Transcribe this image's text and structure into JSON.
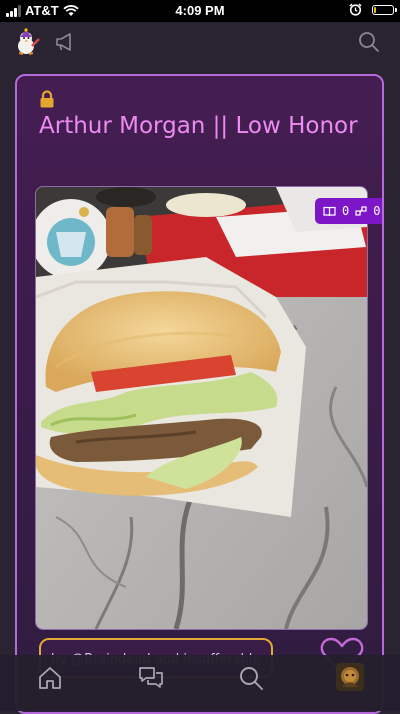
{
  "status_bar": {
    "carrier": "AT&T",
    "time": "4:09 PM",
    "battery_level": 0.12,
    "battery_color": "#f3c300"
  },
  "top_bar": {
    "icons": [
      "app-avatar-icon",
      "megaphone-icon",
      "search-icon"
    ]
  },
  "post": {
    "title": "Arthur Morgan || Low Honor",
    "title_color": "#ee8bf2",
    "locked": true,
    "read_count": "0",
    "share_count": "0",
    "author_text": "by @Braindead and insufferable"
  },
  "bottom_nav": {
    "items": [
      "home-icon",
      "chat-icon",
      "search-icon",
      "profile-avatar"
    ]
  },
  "colors": {
    "card_border": "#b46ad8",
    "badge_bg": "#7c16c6",
    "author_border": "#e0a93a",
    "background": "#2a2332"
  }
}
